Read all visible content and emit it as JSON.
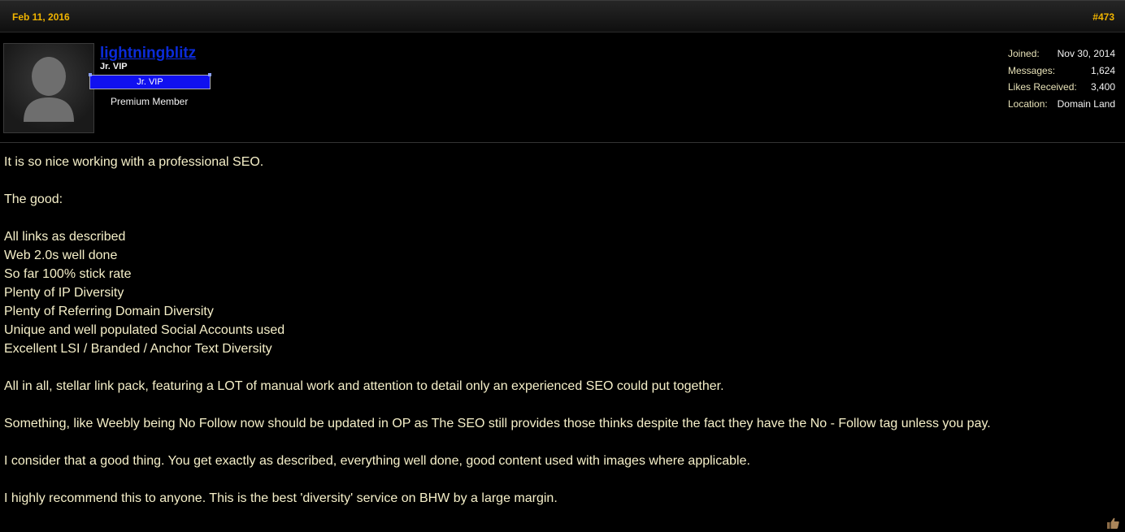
{
  "post": {
    "date": "Feb 11, 2016",
    "number": "#473"
  },
  "user": {
    "name": "lightningblitz",
    "title": "Jr. VIP",
    "banner": "Jr. VIP",
    "membership": "Premium Member"
  },
  "stats": [
    {
      "label": "Joined:",
      "value": "Nov 30, 2014"
    },
    {
      "label": "Messages:",
      "value": "1,624"
    },
    {
      "label": "Likes Received:",
      "value": "3,400"
    },
    {
      "label": "Location:",
      "value": "Domain Land"
    }
  ],
  "message": {
    "intro": "It is so nice working with a professional SEO.",
    "good_heading": "The good:",
    "good_items": [
      "All links as described",
      "Web 2.0s well done",
      "So far 100% stick rate",
      "Plenty of IP Diversity",
      "Plenty of Referring Domain Diversity",
      "Unique and well populated Social Accounts used",
      "Excellent LSI / Branded / Anchor Text Diversity"
    ],
    "para1": "All in all, stellar link pack, featuring a LOT of manual work and attention to detail only an experienced SEO could put together.",
    "para2": "Something, like Weebly being No Follow now should be updated in OP as The SEO still provides those thinks despite the fact they have the No - Follow tag unless you pay.",
    "para3": "I consider that a good thing. You get exactly as described, everything well done, good content used with images where applicable.",
    "para4": "I highly recommend this to anyone. This is the best 'diversity' service on BHW by a large margin."
  },
  "icons": {
    "avatar": "default-avatar-silhouette",
    "like": "thumbs-up-icon"
  },
  "colors": {
    "background": "#000000",
    "text": "#f6f0c9",
    "date_accent": "#f0b400",
    "username": "#0b2bd8",
    "banner": "#1010f0"
  }
}
